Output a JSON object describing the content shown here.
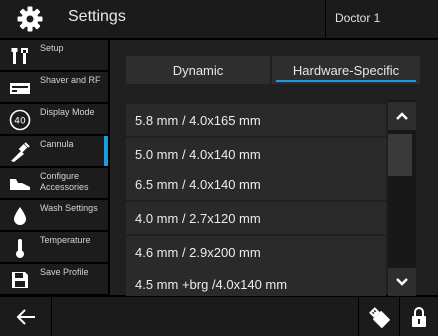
{
  "header": {
    "title": "Settings",
    "user": "Doctor 1"
  },
  "sidebar": {
    "items": [
      {
        "label": "Setup",
        "icon": "tools-icon",
        "active": false
      },
      {
        "label": "Shaver and RF",
        "icon": "console-icon",
        "active": false
      },
      {
        "label": "Display Mode",
        "icon": "display-mode-icon",
        "active": false
      },
      {
        "label": "Cannula",
        "icon": "cannula-icon",
        "active": true
      },
      {
        "label": "Configure Accessories",
        "icon": "accessories-icon",
        "active": false
      },
      {
        "label": "Wash Settings",
        "icon": "drop-icon",
        "active": false
      },
      {
        "label": "Temperature",
        "icon": "thermometer-icon",
        "active": false
      },
      {
        "label": "Save Profile",
        "icon": "save-icon",
        "active": false
      }
    ]
  },
  "tabs": [
    {
      "label": "Dynamic",
      "selected": false
    },
    {
      "label": "Hardware-Specific",
      "selected": true
    }
  ],
  "cannula_list": [
    "5.8 mm / 4.0x165 mm",
    "5.0 mm / 4.0x140 mm",
    "6.5 mm / 4.0x140 mm",
    "4.0 mm / 2.7x120 mm",
    "4.6 mm / 2.9x200 mm",
    "4.5 mm +brg /4.0x140 mm"
  ],
  "colors": {
    "accent": "#1e9be0",
    "panel": "#202020",
    "item": "#2a2a2a"
  },
  "icons": {
    "header": "gear-icon",
    "back": "arrow-left-icon",
    "usb": "usb-icon",
    "lock": "lock-icon",
    "scroll_up": "chevron-up-icon",
    "scroll_down": "chevron-down-icon"
  }
}
